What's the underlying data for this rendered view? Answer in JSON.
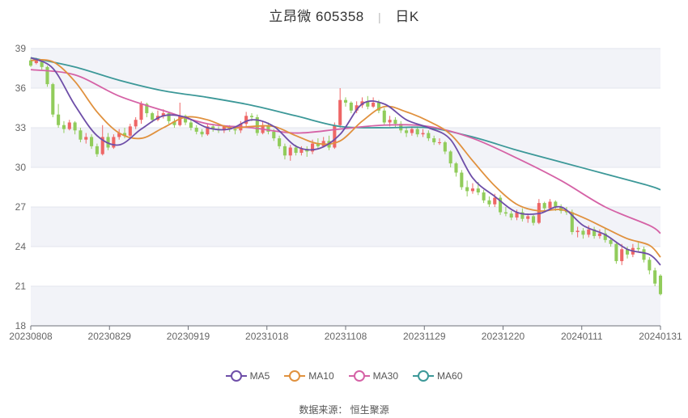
{
  "title": {
    "name": "立昂微",
    "code": "605358",
    "period": "日K"
  },
  "source": "数据来源： 恒生聚源",
  "colors": {
    "up": "#ee6666",
    "down": "#91cc5b",
    "ma5": "#6e4ea8",
    "ma10": "#e0913e",
    "ma30": "#d562a6",
    "ma60": "#3c9898",
    "band": "#f2f3f8",
    "grid": "#e3e6ee"
  },
  "chart_data": {
    "type": "candlestick",
    "ylim": [
      18,
      39
    ],
    "yticks": [
      "18",
      "21",
      "24",
      "27",
      "30",
      "33",
      "36",
      "39"
    ],
    "xticks": [
      "20230808",
      "20230829",
      "20230919",
      "20231018",
      "20231108",
      "20231129",
      "20231220",
      "20240111",
      "20240131"
    ],
    "legend": [
      "MA5",
      "MA10",
      "MA30",
      "MA60"
    ],
    "candles_shape": [
      "t",
      "o",
      "c",
      "h",
      "l"
    ],
    "candles": [
      [
        0,
        38.1,
        37.7,
        38.3,
        37.6
      ],
      [
        1,
        37.9,
        38.2,
        38.3,
        37.8
      ],
      [
        2,
        38.0,
        37.6,
        38.2,
        37.4
      ],
      [
        3,
        37.6,
        36.3,
        37.7,
        36.1
      ],
      [
        4,
        36.3,
        34.0,
        36.4,
        33.8
      ],
      [
        5,
        34.0,
        33.2,
        34.8,
        33.0
      ],
      [
        6,
        33.2,
        32.9,
        33.5,
        32.6
      ],
      [
        7,
        32.9,
        33.4,
        33.6,
        32.8
      ],
      [
        8,
        33.4,
        32.8,
        33.5,
        32.5
      ],
      [
        9,
        32.8,
        32.1,
        33.0,
        31.9
      ],
      [
        10,
        32.1,
        32.3,
        32.6,
        31.8
      ],
      [
        11,
        32.3,
        31.6,
        32.5,
        31.4
      ],
      [
        12,
        31.6,
        31.0,
        31.8,
        30.8
      ],
      [
        13,
        31.0,
        32.3,
        33.2,
        30.9
      ],
      [
        14,
        32.3,
        31.5,
        32.6,
        31.3
      ],
      [
        15,
        31.5,
        32.3,
        32.5,
        31.4
      ],
      [
        16,
        32.3,
        32.6,
        32.9,
        32.1
      ],
      [
        17,
        32.6,
        32.4,
        33.0,
        32.2
      ],
      [
        18,
        32.4,
        33.1,
        33.3,
        32.3
      ],
      [
        19,
        33.1,
        33.6,
        33.8,
        32.9
      ],
      [
        20,
        33.6,
        34.8,
        35.0,
        33.3
      ],
      [
        21,
        34.8,
        34.1,
        34.9,
        33.8
      ],
      [
        22,
        34.1,
        33.6,
        34.2,
        33.4
      ],
      [
        23,
        33.6,
        33.9,
        34.3,
        33.5
      ],
      [
        24,
        33.9,
        34.1,
        34.4,
        33.7
      ],
      [
        25,
        34.1,
        33.5,
        34.2,
        33.3
      ],
      [
        26,
        33.5,
        33.2,
        33.7,
        33.0
      ],
      [
        27,
        33.2,
        33.9,
        34.9,
        33.1
      ],
      [
        28,
        33.9,
        33.4,
        34.0,
        33.2
      ],
      [
        29,
        33.4,
        33.0,
        33.6,
        32.8
      ],
      [
        30,
        33.0,
        32.7,
        33.2,
        32.5
      ],
      [
        31,
        32.7,
        32.5,
        32.9,
        32.3
      ],
      [
        32,
        32.5,
        33.1,
        33.3,
        32.4
      ],
      [
        33,
        33.1,
        32.9,
        33.3,
        32.7
      ],
      [
        34,
        32.9,
        32.8,
        33.1,
        32.6
      ],
      [
        35,
        32.8,
        33.1,
        33.2,
        32.6
      ],
      [
        36,
        33.1,
        32.9,
        33.2,
        32.7
      ],
      [
        37,
        32.9,
        32.8,
        33.0,
        32.5
      ],
      [
        38,
        32.8,
        33.3,
        33.5,
        32.6
      ],
      [
        39,
        33.3,
        33.9,
        34.2,
        33.1
      ],
      [
        40,
        33.9,
        33.8,
        34.1,
        33.5
      ],
      [
        41,
        33.8,
        32.6,
        34.0,
        32.4
      ],
      [
        42,
        32.6,
        33.2,
        33.5,
        32.5
      ],
      [
        43,
        33.2,
        32.7,
        33.4,
        32.5
      ],
      [
        44,
        32.7,
        32.2,
        32.9,
        32.0
      ],
      [
        45,
        32.2,
        31.6,
        32.4,
        31.4
      ],
      [
        46,
        31.6,
        30.9,
        31.8,
        30.6
      ],
      [
        47,
        30.9,
        31.5,
        31.7,
        30.5
      ],
      [
        48,
        31.5,
        31.1,
        31.7,
        30.9
      ],
      [
        49,
        31.1,
        31.4,
        31.6,
        30.9
      ],
      [
        50,
        31.4,
        31.2,
        31.6,
        30.8
      ],
      [
        51,
        31.2,
        31.8,
        32.1,
        31.0
      ],
      [
        52,
        31.8,
        31.6,
        32.2,
        31.4
      ],
      [
        53,
        31.6,
        32.0,
        32.3,
        31.5
      ],
      [
        54,
        32.0,
        31.5,
        32.4,
        31.3
      ],
      [
        55,
        31.5,
        33.2,
        33.4,
        31.4
      ],
      [
        56,
        33.2,
        35.1,
        36.0,
        33.0
      ],
      [
        57,
        35.1,
        34.9,
        35.3,
        34.6
      ],
      [
        58,
        34.9,
        34.3,
        35.0,
        34.1
      ],
      [
        59,
        34.3,
        34.7,
        35.0,
        34.1
      ],
      [
        60,
        34.7,
        35.0,
        35.3,
        34.5
      ],
      [
        61,
        35.0,
        34.6,
        35.4,
        34.4
      ],
      [
        62,
        34.6,
        34.9,
        35.3,
        34.5
      ],
      [
        63,
        34.9,
        34.3,
        35.1,
        34.1
      ],
      [
        64,
        34.3,
        33.4,
        34.5,
        33.2
      ],
      [
        65,
        33.4,
        33.6,
        33.9,
        33.1
      ],
      [
        66,
        33.6,
        33.3,
        33.8,
        33.0
      ],
      [
        67,
        33.3,
        32.8,
        33.5,
        32.6
      ],
      [
        68,
        32.8,
        32.6,
        33.0,
        32.3
      ],
      [
        69,
        32.6,
        32.9,
        33.1,
        32.4
      ],
      [
        70,
        32.9,
        32.5,
        33.1,
        32.3
      ],
      [
        71,
        32.5,
        32.6,
        32.9,
        32.3
      ],
      [
        72,
        32.6,
        32.2,
        32.8,
        32.0
      ],
      [
        73,
        32.2,
        31.9,
        32.4,
        31.7
      ],
      [
        74,
        31.9,
        31.9,
        32.2,
        31.7
      ],
      [
        75,
        31.9,
        31.2,
        32.0,
        31.0
      ],
      [
        76,
        31.2,
        30.3,
        31.3,
        30.0
      ],
      [
        77,
        30.3,
        29.6,
        30.4,
        29.3
      ],
      [
        78,
        29.6,
        28.5,
        29.8,
        28.3
      ],
      [
        79,
        28.5,
        28.2,
        29.0,
        27.8
      ],
      [
        80,
        28.2,
        28.4,
        28.8,
        28.0
      ],
      [
        81,
        28.4,
        28.1,
        28.9,
        27.9
      ],
      [
        82,
        28.1,
        27.5,
        28.3,
        27.3
      ],
      [
        83,
        27.5,
        27.2,
        27.8,
        27.0
      ],
      [
        84,
        27.2,
        27.7,
        28.0,
        27.0
      ],
      [
        85,
        27.7,
        26.6,
        27.9,
        26.4
      ],
      [
        86,
        26.6,
        26.5,
        27.0,
        26.3
      ],
      [
        87,
        26.5,
        26.2,
        26.7,
        26.0
      ],
      [
        88,
        26.2,
        26.6,
        26.8,
        26.0
      ],
      [
        89,
        26.6,
        26.1,
        26.9,
        25.9
      ],
      [
        90,
        26.1,
        26.3,
        26.5,
        25.8
      ],
      [
        91,
        26.3,
        25.8,
        26.4,
        25.6
      ],
      [
        92,
        25.8,
        27.3,
        27.6,
        25.7
      ],
      [
        93,
        27.3,
        26.9,
        27.4,
        26.7
      ],
      [
        94,
        26.9,
        27.4,
        27.6,
        26.8
      ],
      [
        95,
        27.4,
        27.0,
        27.5,
        26.7
      ],
      [
        96,
        27.0,
        26.7,
        27.2,
        26.5
      ],
      [
        97,
        26.7,
        26.6,
        27.0,
        26.4
      ],
      [
        98,
        26.6,
        25.1,
        26.8,
        24.9
      ],
      [
        99,
        25.1,
        25.2,
        25.5,
        24.7
      ],
      [
        100,
        25.2,
        24.9,
        25.4,
        24.6
      ],
      [
        101,
        24.9,
        25.3,
        25.6,
        24.7
      ],
      [
        102,
        25.3,
        24.8,
        25.5,
        24.6
      ],
      [
        103,
        24.8,
        25.0,
        25.3,
        24.6
      ],
      [
        104,
        25.0,
        24.5,
        25.4,
        24.3
      ],
      [
        105,
        24.5,
        24.2,
        24.7,
        24.0
      ],
      [
        106,
        24.2,
        22.9,
        24.4,
        22.7
      ],
      [
        107,
        22.9,
        23.8,
        24.2,
        22.6
      ],
      [
        108,
        23.8,
        23.4,
        24.0,
        23.1
      ],
      [
        109,
        23.4,
        23.9,
        24.2,
        23.2
      ],
      [
        110,
        23.9,
        23.8,
        24.3,
        23.6
      ],
      [
        111,
        23.8,
        23.0,
        24.0,
        22.8
      ],
      [
        112,
        23.0,
        22.2,
        23.2,
        21.9
      ],
      [
        113,
        22.2,
        21.2,
        22.4,
        21.0
      ],
      [
        114,
        21.8,
        20.4,
        21.9,
        20.3
      ]
    ],
    "ma5": [
      [
        0,
        38.3
      ],
      [
        4,
        37.5
      ],
      [
        8,
        34.7
      ],
      [
        12,
        32.4
      ],
      [
        16,
        31.7
      ],
      [
        20,
        32.9
      ],
      [
        24,
        33.9
      ],
      [
        28,
        33.8
      ],
      [
        32,
        33.0
      ],
      [
        36,
        32.9
      ],
      [
        40,
        33.6
      ],
      [
        44,
        33.1
      ],
      [
        48,
        31.6
      ],
      [
        52,
        31.4
      ],
      [
        56,
        32.5
      ],
      [
        60,
        34.8
      ],
      [
        64,
        34.8
      ],
      [
        68,
        33.6
      ],
      [
        72,
        33.0
      ],
      [
        76,
        32.1
      ],
      [
        80,
        29.2
      ],
      [
        84,
        27.8
      ],
      [
        88,
        26.6
      ],
      [
        92,
        26.5
      ],
      [
        96,
        27.0
      ],
      [
        100,
        25.6
      ],
      [
        104,
        24.9
      ],
      [
        108,
        23.8
      ],
      [
        112,
        23.4
      ],
      [
        114,
        22.6
      ]
    ],
    "ma10": [
      [
        0,
        38.1
      ],
      [
        4,
        38.0
      ],
      [
        8,
        36.5
      ],
      [
        12,
        34.2
      ],
      [
        16,
        32.6
      ],
      [
        20,
        32.2
      ],
      [
        24,
        33.0
      ],
      [
        28,
        33.8
      ],
      [
        32,
        33.6
      ],
      [
        36,
        33.0
      ],
      [
        40,
        33.1
      ],
      [
        44,
        33.1
      ],
      [
        48,
        32.4
      ],
      [
        52,
        31.8
      ],
      [
        56,
        32.0
      ],
      [
        60,
        33.5
      ],
      [
        64,
        34.6
      ],
      [
        68,
        34.2
      ],
      [
        72,
        33.5
      ],
      [
        76,
        32.5
      ],
      [
        80,
        30.5
      ],
      [
        84,
        28.6
      ],
      [
        88,
        27.2
      ],
      [
        92,
        26.7
      ],
      [
        96,
        26.8
      ],
      [
        100,
        26.2
      ],
      [
        104,
        25.4
      ],
      [
        108,
        24.6
      ],
      [
        112,
        24.1
      ],
      [
        114,
        23.2
      ]
    ],
    "ma30": [
      [
        0,
        37.4
      ],
      [
        8,
        37.0
      ],
      [
        16,
        35.4
      ],
      [
        24,
        34.3
      ],
      [
        32,
        33.3
      ],
      [
        40,
        33.0
      ],
      [
        48,
        32.6
      ],
      [
        56,
        32.9
      ],
      [
        64,
        33.2
      ],
      [
        72,
        33.1
      ],
      [
        80,
        32.2
      ],
      [
        88,
        30.7
      ],
      [
        96,
        29.0
      ],
      [
        104,
        27.0
      ],
      [
        112,
        25.6
      ],
      [
        114,
        25.0
      ]
    ],
    "ma60": [
      [
        0,
        38.3
      ],
      [
        8,
        37.6
      ],
      [
        16,
        36.6
      ],
      [
        24,
        35.8
      ],
      [
        32,
        35.3
      ],
      [
        40,
        34.7
      ],
      [
        48,
        33.9
      ],
      [
        56,
        33.1
      ],
      [
        64,
        33.0
      ],
      [
        72,
        33.0
      ],
      [
        80,
        32.3
      ],
      [
        88,
        31.3
      ],
      [
        96,
        30.4
      ],
      [
        104,
        29.5
      ],
      [
        112,
        28.6
      ],
      [
        114,
        28.3
      ]
    ]
  }
}
